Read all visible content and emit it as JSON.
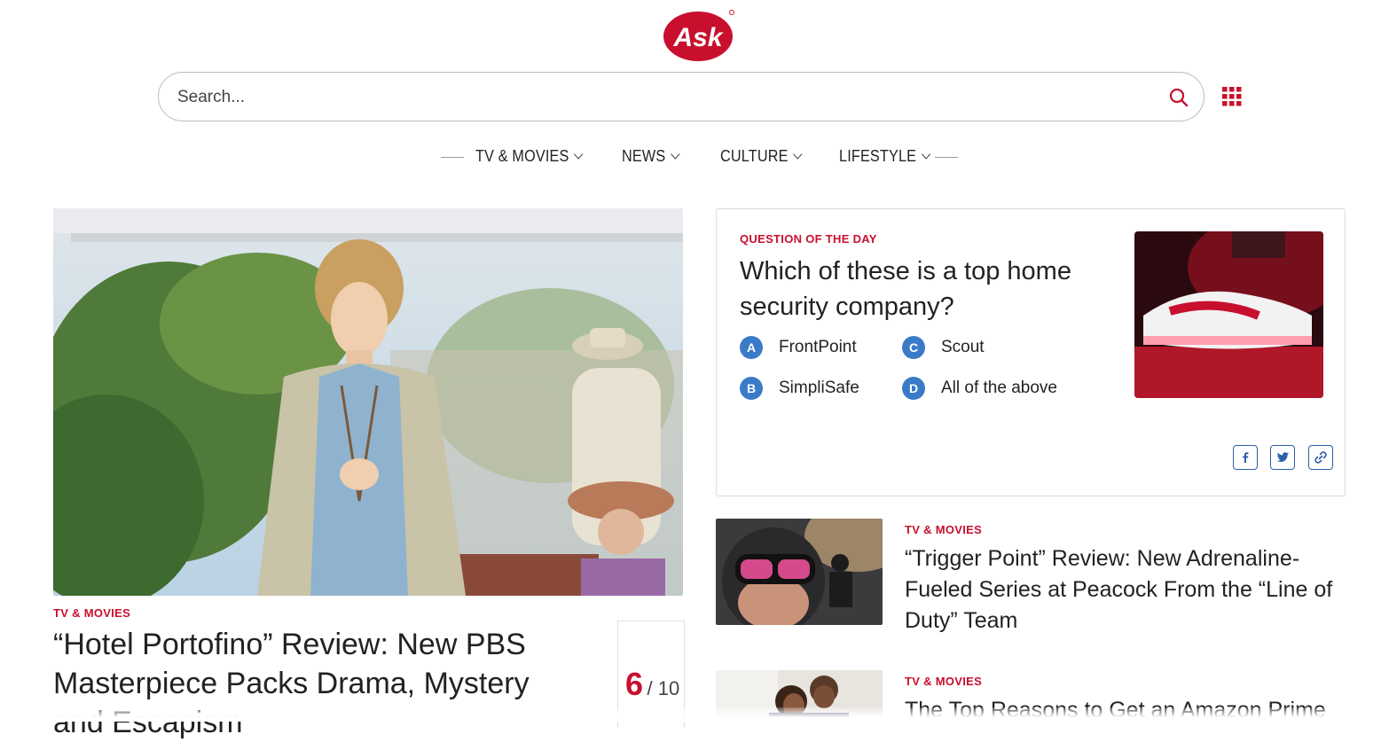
{
  "brand": {
    "logo_text": "Ask",
    "accent": "#c8102e",
    "badge_blue": "#3a7bc8"
  },
  "search": {
    "placeholder": "Search...",
    "value": ""
  },
  "nav": {
    "items": [
      {
        "label": "TV & MOVIES"
      },
      {
        "label": "NEWS"
      },
      {
        "label": "CULTURE"
      },
      {
        "label": "LIFESTYLE"
      }
    ]
  },
  "hero": {
    "category": "TV & MOVIES",
    "title": "“Hotel Portofino” Review: New PBS Masterpiece Packs Drama, Mystery and Escapism",
    "score": "6",
    "score_denominator": "/ 10"
  },
  "qotd": {
    "label": "QUESTION OF THE DAY",
    "question": "Which of these is a top home security company?",
    "options": [
      {
        "letter": "A",
        "text": "FrontPoint"
      },
      {
        "letter": "B",
        "text": "SimpliSafe"
      },
      {
        "letter": "C",
        "text": "Scout"
      },
      {
        "letter": "D",
        "text": "All of the above"
      }
    ],
    "share_icons": [
      "facebook-icon",
      "twitter-icon",
      "link-icon"
    ]
  },
  "articles": [
    {
      "category": "TV & MOVIES",
      "title": "“Trigger Point” Review: New Adrenaline-Fueled Series at Peacock From the “Line of Duty” Team"
    },
    {
      "category": "TV & MOVIES",
      "title": "The Top Reasons to Get an Amazon Prime"
    }
  ]
}
